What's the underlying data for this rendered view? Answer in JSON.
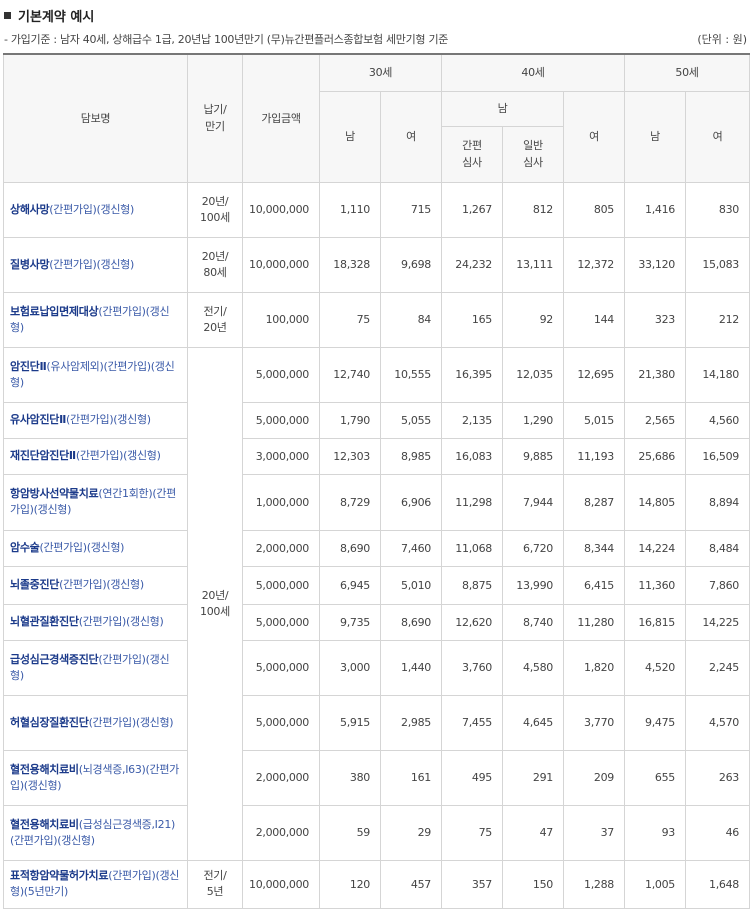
{
  "title": "기본계약 예시",
  "condition": "- 가입기준 : 남자 40세, 상해급수 1급, 20년납 100년만기 (무)뉴간편플러스종합보험 세만기형 기준",
  "unit": "(단위 : 원)",
  "headers": {
    "name": "담보명",
    "term": "납기/\n만기",
    "amount": "가입금액",
    "age30": "30세",
    "age40": "40세",
    "age50": "50세",
    "male": "남",
    "female": "여",
    "simple": "간편\n심사",
    "normal": "일반\n심사"
  },
  "rows": [
    {
      "parts": [
        {
          "t": "상해사망",
          "c": "n"
        },
        {
          "t": "(간편가입)(갱신형)",
          "c": "sub"
        }
      ],
      "term": "20년/\n100세",
      "amount": "10,000,000",
      "vals": [
        "1,110",
        "715",
        "1,267",
        "812",
        "805",
        "1,416",
        "830"
      ]
    },
    {
      "parts": [
        {
          "t": "질병사망",
          "c": "n"
        },
        {
          "t": "(간편가입)(갱신형)",
          "c": "sub"
        }
      ],
      "term": "20년/\n80세",
      "amount": "10,000,000",
      "vals": [
        "18,328",
        "9,698",
        "24,232",
        "13,111",
        "12,372",
        "33,120",
        "15,083"
      ]
    },
    {
      "parts": [
        {
          "t": "보험료납입면제대상",
          "c": "n"
        },
        {
          "t": "(간편가입)(갱신형)",
          "c": "sub"
        }
      ],
      "term": "전기/\n20년",
      "amount": "100,000",
      "vals": [
        "75",
        "84",
        "165",
        "92",
        "144",
        "323",
        "212"
      ]
    },
    {
      "parts": [
        {
          "t": "암진단Ⅱ",
          "c": "n"
        },
        {
          "t": "(유사암제외)(간편가입)(갱신형)",
          "c": "sub"
        }
      ],
      "term": "20년/\n100세",
      "amount": "5,000,000",
      "vals": [
        "12,740",
        "10,555",
        "16,395",
        "12,035",
        "12,695",
        "21,380",
        "14,180"
      ]
    },
    {
      "parts": [
        {
          "t": "유사암진단Ⅱ",
          "c": "n"
        },
        {
          "t": "(간편가입)(갱신형)",
          "c": "sub"
        }
      ],
      "amount": "5,000,000",
      "vals": [
        "1,790",
        "5,055",
        "2,135",
        "1,290",
        "5,015",
        "2,565",
        "4,560"
      ]
    },
    {
      "parts": [
        {
          "t": "재진단암진단Ⅱ",
          "c": "n"
        },
        {
          "t": "(간편가입)(갱신형)",
          "c": "sub"
        }
      ],
      "amount": "3,000,000",
      "vals": [
        "12,303",
        "8,985",
        "16,083",
        "9,885",
        "11,193",
        "25,686",
        "16,509"
      ]
    },
    {
      "parts": [
        {
          "t": "항암방사선약물치료",
          "c": "n"
        },
        {
          "t": "(연간1회한)(간편가입)(갱신형)",
          "c": "sub"
        }
      ],
      "amount": "1,000,000",
      "vals": [
        "8,729",
        "6,906",
        "11,298",
        "7,944",
        "8,287",
        "14,805",
        "8,894"
      ]
    },
    {
      "parts": [
        {
          "t": "암수술",
          "c": "n"
        },
        {
          "t": "(간편가입)(갱신형)",
          "c": "sub"
        }
      ],
      "amount": "2,000,000",
      "vals": [
        "8,690",
        "7,460",
        "11,068",
        "6,720",
        "8,344",
        "14,224",
        "8,484"
      ]
    },
    {
      "parts": [
        {
          "t": "뇌졸중진단",
          "c": "n"
        },
        {
          "t": "(간편가입)(갱신형)",
          "c": "sub"
        }
      ],
      "amount": "5,000,000",
      "vals": [
        "6,945",
        "5,010",
        "8,875",
        "13,990",
        "6,415",
        "11,360",
        "7,860"
      ]
    },
    {
      "parts": [
        {
          "t": "뇌혈관질환진단",
          "c": "n"
        },
        {
          "t": "(간편가입)(갱신형)",
          "c": "sub"
        }
      ],
      "amount": "5,000,000",
      "vals": [
        "9,735",
        "8,690",
        "12,620",
        "8,740",
        "11,280",
        "16,815",
        "14,225"
      ]
    },
    {
      "parts": [
        {
          "t": "급성심근경색증진단",
          "c": "n"
        },
        {
          "t": "(간편가입)(갱신형)",
          "c": "sub"
        }
      ],
      "amount": "5,000,000",
      "vals": [
        "3,000",
        "1,440",
        "3,760",
        "4,580",
        "1,820",
        "4,520",
        "2,245"
      ]
    },
    {
      "parts": [
        {
          "t": "허혈심장질환진단",
          "c": "n"
        },
        {
          "t": "(간편가입)(갱신형)",
          "c": "sub"
        }
      ],
      "amount": "5,000,000",
      "vals": [
        "5,915",
        "2,985",
        "7,455",
        "4,645",
        "3,770",
        "9,475",
        "4,570"
      ]
    },
    {
      "parts": [
        {
          "t": "혈전용해치료비",
          "c": "n"
        },
        {
          "t": "(뇌경색증,I63)(간편가입)(갱신형)",
          "c": "sub"
        }
      ],
      "amount": "2,000,000",
      "vals": [
        "380",
        "161",
        "495",
        "291",
        "209",
        "655",
        "263"
      ]
    },
    {
      "parts": [
        {
          "t": "혈전용해치료비",
          "c": "n"
        },
        {
          "t": "(급성심근경색증,I21)(간편가입)(갱신형)",
          "c": "sub"
        }
      ],
      "amount": "2,000,000",
      "vals": [
        "59",
        "29",
        "75",
        "47",
        "37",
        "93",
        "46"
      ]
    },
    {
      "parts": [
        {
          "t": "표적항암약물허가치료",
          "c": "n"
        },
        {
          "t": "(간편가입)(갱신형)(5년만기)",
          "c": "sub"
        }
      ],
      "term": "전기/\n5년",
      "amount": "10,000,000",
      "vals": [
        "120",
        "457",
        "357",
        "150",
        "1,288",
        "1,005",
        "1,648"
      ]
    }
  ]
}
